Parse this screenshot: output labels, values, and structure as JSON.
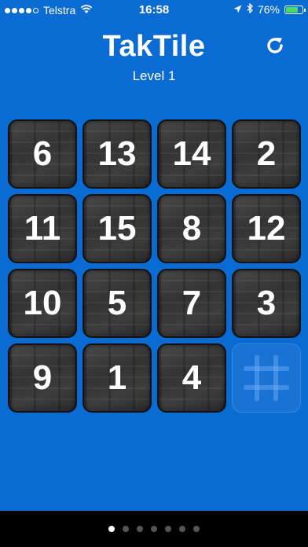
{
  "status": {
    "carrier": "Telstra",
    "time": "16:58",
    "battery": "76%",
    "battery_level": 0.76,
    "signal_bars": 4,
    "signal_total": 5
  },
  "app": {
    "title": "TakTile",
    "level": "Level 1"
  },
  "board": {
    "rows": [
      [
        "6",
        "13",
        "14",
        "2"
      ],
      [
        "11",
        "15",
        "8",
        "12"
      ],
      [
        "10",
        "5",
        "7",
        "3"
      ],
      [
        "9",
        "1",
        "4",
        ""
      ]
    ]
  },
  "pages": {
    "count": 7,
    "active": 0
  },
  "icons": {
    "refresh": "refresh-icon",
    "empty_tile": "hash-icon"
  }
}
